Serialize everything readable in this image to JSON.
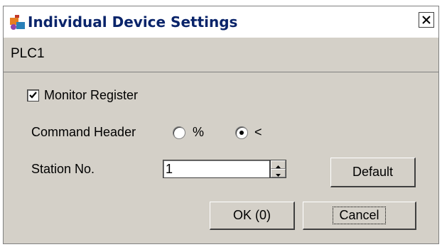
{
  "window": {
    "title": "Individual Device Settings"
  },
  "device": {
    "name": "PLC1"
  },
  "monitor_register": {
    "label": "Monitor Register",
    "checked": true
  },
  "command_header": {
    "label": "Command Header",
    "options": [
      "%",
      "<"
    ],
    "selected": "<"
  },
  "station": {
    "label": "Station No.",
    "value": "1"
  },
  "buttons": {
    "default": "Default",
    "ok": "OK (0)",
    "cancel": "Cancel"
  },
  "icons": {
    "title": "settings-icon",
    "close": "close-icon"
  }
}
